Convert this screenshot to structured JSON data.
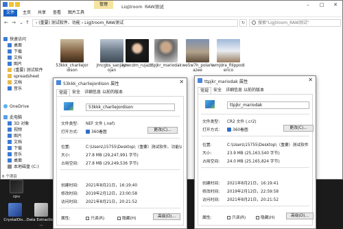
{
  "desktop": {
    "icons": [
      "cpu",
      "CrystalDis...",
      "Data Extraction ..."
    ]
  },
  "explorer": {
    "manage_tab": "管理",
    "title": "Ligjtroom_RAW测试",
    "ribbon_tabs": [
      "文件",
      "主页",
      "共享",
      "查看",
      "图片工具"
    ],
    "address": "›  (重要) 测试软件、功能  ›  Ligjtroom_RAW测试",
    "search_placeholder": "搜索\"Ligjtroom_RAW测试\"",
    "nav": {
      "quick_access": "快速访问",
      "items": [
        "桌面",
        "下载",
        "文档",
        "图片",
        "(重要) 测试软件",
        "spreadsheet",
        "文档",
        "音乐"
      ],
      "onedrive": "OneDrive",
      "this_pc": "此电脑",
      "pc_items": [
        "3D 对象",
        "视频",
        "图片",
        "文档",
        "下载",
        "音乐",
        "桌面",
        "本地磁盘 (C:)"
      ]
    },
    "files": [
      "53kkk_charliejordison",
      "jmcgbs_sanjayrojan",
      "kowcdm_rujazz",
      "ttpjkr_mariodak",
      "we5w7h_polarkazee",
      "wmjdra_filippodierico"
    ],
    "status": "6 个项目"
  },
  "dialog_left": {
    "title": "53kkk_charliejordison 属性",
    "tabs": [
      "常规",
      "安全",
      "详细信息",
      "以前的版本"
    ],
    "name": "53kkk_charliejordison",
    "rows": {
      "file_type_label": "文件类型:",
      "file_type": "NEF 文件 (.nef)",
      "open_with_label": "打开方式:",
      "open_with": "360看图",
      "change": "更改(C)...",
      "location_label": "位置:",
      "location": "C:\\Users\\15755\\Desktop\\（重要）测试软件、功能\\Li",
      "size_label": "大小:",
      "size": "27.8 MB (29,247,991 字节)",
      "disk_size_label": "占用空间:",
      "disk_size": "27.8 MB (29,249,536 字节)",
      "created_label": "创建时间:",
      "created": "2021年8月21日，16:19:40",
      "modified_label": "修改时间:",
      "modified": "2019年2月12日，23:00:58",
      "accessed_label": "访问时间:",
      "accessed": "2021年8月21日，20:21:52",
      "attributes_label": "属性:",
      "readonly": "只读(R)",
      "hidden": "隐藏(H)",
      "advanced": "高级(D)..."
    }
  },
  "dialog_right": {
    "title": "ttpjkr_mariodak 属性",
    "tabs": [
      "常规",
      "安全",
      "详细信息",
      "以前的版本"
    ],
    "name": "ttpjkr_mariodak",
    "rows": {
      "file_type_label": "文件类型:",
      "file_type": "CR2 文件 (.cr2)",
      "open_with_label": "打开方式:",
      "open_with": "360看图",
      "change": "更改(C)...",
      "location_label": "位置:",
      "location": "C:\\Users\\15755\\Desktop\\（重要）测试软件",
      "size_label": "大小:",
      "size": "23.9 MB (25,163,540 字节)",
      "disk_size_label": "占用空间:",
      "disk_size": "24.0 MB (25,165,824 字节)",
      "created_label": "创建时间:",
      "created": "2021年8月21日，16:19:41",
      "modified_label": "修改时间:",
      "modified": "2019年2月12日，22:59:58",
      "accessed_label": "访问时间:",
      "accessed": "2021年8月21日，20:21:52",
      "attributes_label": "属性:",
      "readonly": "只读(R)",
      "hidden": "隐藏(H)",
      "advanced": "高级(D)..."
    }
  },
  "colors": {
    "accent": "#1a62c6",
    "manage_tab": "#f6e3a0",
    "selection": "#cfe2f8"
  }
}
